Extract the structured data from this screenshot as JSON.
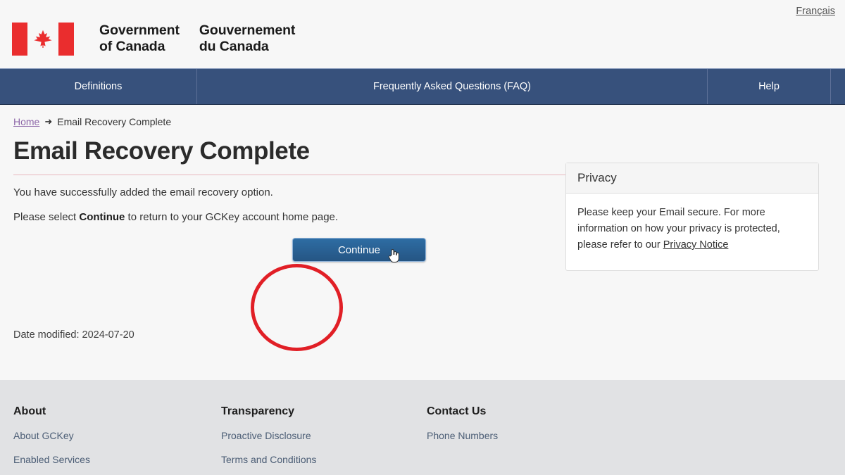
{
  "header": {
    "lang_link": "Français",
    "brand_en": "Government\nof Canada",
    "brand_en_line1": "Government",
    "brand_en_line2": "of Canada",
    "brand_fr_line1": "Gouvernement",
    "brand_fr_line2": "du Canada",
    "flag_icon": "canada-flag-icon"
  },
  "nav": {
    "items": [
      {
        "label": "Definitions"
      },
      {
        "label": "Frequently Asked Questions (FAQ)"
      },
      {
        "label": "Help"
      }
    ]
  },
  "breadcrumb": {
    "home": "Home",
    "arrow": "➜",
    "current": "Email Recovery Complete"
  },
  "main": {
    "title": "Email Recovery Complete",
    "paragraph_1": "You have successfully added the email recovery option.",
    "paragraph_2_pre": "Please select ",
    "paragraph_2_bold": "Continue",
    "paragraph_2_post": " to return to your GCKey account home page.",
    "continue_label": "Continue",
    "cursor_icon": "pointing-hand-cursor",
    "annotation_icon": "red-circle-highlight",
    "date_modified": "Date modified: 2024-07-20"
  },
  "privacy": {
    "heading": "Privacy",
    "body_pre": "Please keep your Email secure. For more information on how your privacy is protected, please refer to our ",
    "link": "Privacy Notice"
  },
  "footer": {
    "columns": [
      {
        "heading": "About",
        "links": [
          "About GCKey",
          "Enabled Services"
        ]
      },
      {
        "heading": "Transparency",
        "links": [
          "Proactive Disclosure",
          "Terms and Conditions"
        ]
      },
      {
        "heading": "Contact Us",
        "links": [
          "Phone Numbers"
        ]
      }
    ]
  },
  "colors": {
    "nav_blue": "#37517c",
    "button_blue": "#2e6da4",
    "flag_red": "#ea2d2e",
    "annotation_red": "#e11f26",
    "rule_pink": "#e8b8bd",
    "footer_gray": "#e1e2e4",
    "visited_link": "#8d67a8"
  }
}
